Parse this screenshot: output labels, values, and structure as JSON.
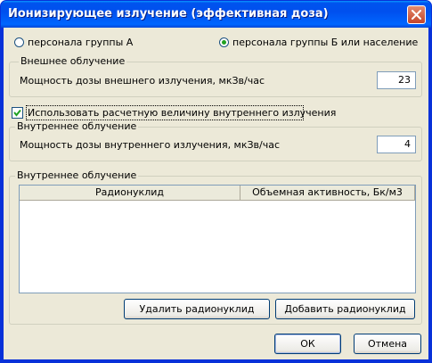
{
  "window": {
    "title": "Ионизирующее излучение (эффективная доза)",
    "close_icon": "close-icon"
  },
  "personnel_group": {
    "option_a": {
      "label": "персонала группы А",
      "selected": false
    },
    "option_b": {
      "label": "персонала группы Б или население",
      "selected": true
    }
  },
  "external": {
    "group_label": "Внешнее облучение",
    "field_label": "Мощность дозы внешнего излучения, мкЗв/час",
    "value": "23"
  },
  "use_internal": {
    "label": "Использовать расчетную величину внутреннего излучения",
    "checked": true
  },
  "internal": {
    "group_label": "Внутреннее облучение",
    "field_label": "Мощность дозы внутреннего излучения, мкЗв/час",
    "value": "4"
  },
  "nuclides": {
    "group_label": "Внутреннее облучение",
    "columns": [
      "Радионуклид",
      "Объемная активность, Бк/м3"
    ],
    "rows": [],
    "remove_label": "Удалить радионуклид",
    "add_label": "Добавить радионуклид"
  },
  "footer": {
    "ok_label": "ОК",
    "cancel_label": "Отмена"
  },
  "colors": {
    "title_bar": "#0054e3",
    "dialog_bg": "#ece9d8",
    "radio_dot": "#21a121",
    "checkmark": "#21a121"
  }
}
